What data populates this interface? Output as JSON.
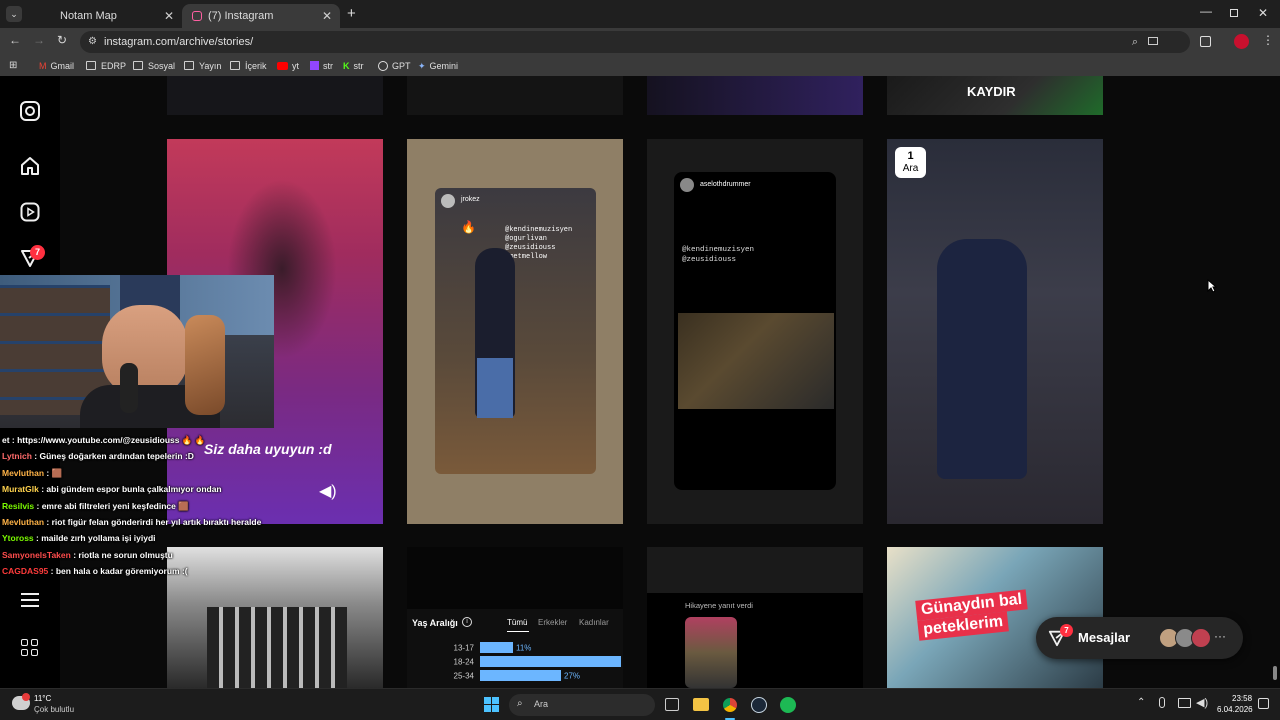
{
  "browser": {
    "tabs": [
      {
        "label": "Notam Map",
        "active": false
      },
      {
        "label": "(7) Instagram",
        "active": true
      }
    ],
    "url": "instagram.com/archive/stories/",
    "bookmarks": [
      "Gmail",
      "EDRP",
      "Sosyal",
      "Yayın",
      "İçerik",
      "yt",
      "str",
      "str",
      "GPT",
      "Gemini"
    ]
  },
  "instagram": {
    "notification_count": "7",
    "stories": {
      "row0_text": "KAYDIR",
      "s1_caption": "Siz daha uyuyun :d",
      "s2_user": "jrokez",
      "s2_tags": [
        "@kendinemuzisyen",
        "@ogurlivan",
        "@zeusidiouss",
        "@metmellow"
      ],
      "s3_user": "aselothdrummer",
      "s3_tags": [
        "@kendinemuzisyen",
        "@zeusidiouss"
      ],
      "s4_date_day": "1",
      "s4_date_month": "Ara",
      "s7_reply": "Hikayene yanıt verdi",
      "s8_sticker_1": "Günaydın bal",
      "s8_sticker_2": "peteklerim"
    },
    "age_chart": {
      "title": "Yaş Aralığı",
      "tabs": [
        "Tümü",
        "Erkekler",
        "Kadınlar"
      ],
      "active_tab": "Tümü"
    },
    "messages": {
      "label": "Mesajlar",
      "badge": "7"
    }
  },
  "chart_data": {
    "type": "bar",
    "title": "Yaş Aralığı",
    "categories": [
      "13-17",
      "18-24",
      "25-34"
    ],
    "values": [
      11,
      47,
      27
    ],
    "value_labels": [
      "11%",
      "47%",
      "27%"
    ],
    "xlim": [
      0,
      50
    ]
  },
  "chat": [
    {
      "user": "et",
      "user_color": "#ffffff",
      "text": "https://www.youtube.com/@zeusidiouss 🔥 🔥"
    },
    {
      "user": "Lytnich",
      "user_color": "#ff6b6b",
      "text": "Güneş doğarken ardından tepelerin :D"
    },
    {
      "user": "Mevluthan",
      "user_color": "#ffb347",
      "text": "🟫"
    },
    {
      "user": "MuratGlk",
      "user_color": "#ffd24d",
      "text": "abi gündem espor bunla çalkalmıyor ondan"
    },
    {
      "user": "Resilvis",
      "user_color": "#7cfc00",
      "text": "emre abi filtreleri yeni keşfedince 🟫"
    },
    {
      "user": "Mevluthan",
      "user_color": "#ffb347",
      "text": "riot figür felan gönderirdi her yıl artık bıraktı heralde"
    },
    {
      "user": "Ytoross",
      "user_color": "#7cfc00",
      "text": "mailde zırh yollama işi iyiydi"
    },
    {
      "user": "SamyonelsTaken",
      "user_color": "#ff4d4d",
      "text": "riotla ne sorun olmuştu"
    },
    {
      "user": "CAGDAS95",
      "user_color": "#ff3b3b",
      "text": "ben hala o kadar göremiyorum :("
    }
  ],
  "taskbar": {
    "weather_temp": "11°C",
    "weather_desc": "Çok bulutlu",
    "search_placeholder": "Ara",
    "time": "23:58",
    "date": "6.04.2026"
  }
}
